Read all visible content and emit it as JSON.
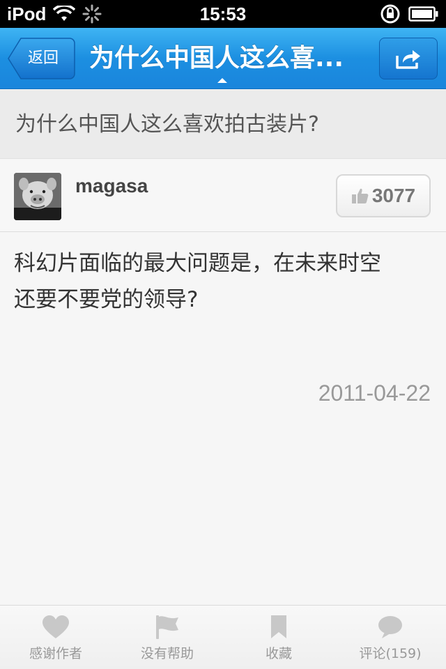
{
  "status_bar": {
    "carrier": "iPod",
    "time": "15:53"
  },
  "nav": {
    "back_label": "返回",
    "title": "为什么中国人这么喜..."
  },
  "question": {
    "title": "为什么中国人这么喜欢拍古装片?"
  },
  "answer": {
    "author": "magasa",
    "likes": "3077",
    "line1": "科幻片面临的最大问题是，在未来时空",
    "line2": "还要不要党的领导?",
    "date": "2011-04-22"
  },
  "toolbar": {
    "items": [
      {
        "label": "感谢作者",
        "icon": "heart-icon"
      },
      {
        "label": "没有帮助",
        "icon": "flag-icon"
      },
      {
        "label": "收藏",
        "icon": "bookmark-icon"
      },
      {
        "label": "评论(159)",
        "icon": "comment-icon"
      }
    ]
  },
  "colors": {
    "nav_blue": "#1c8fe1",
    "background": "#f6f6f6",
    "toolbar_icon": "#c8c8c8"
  }
}
